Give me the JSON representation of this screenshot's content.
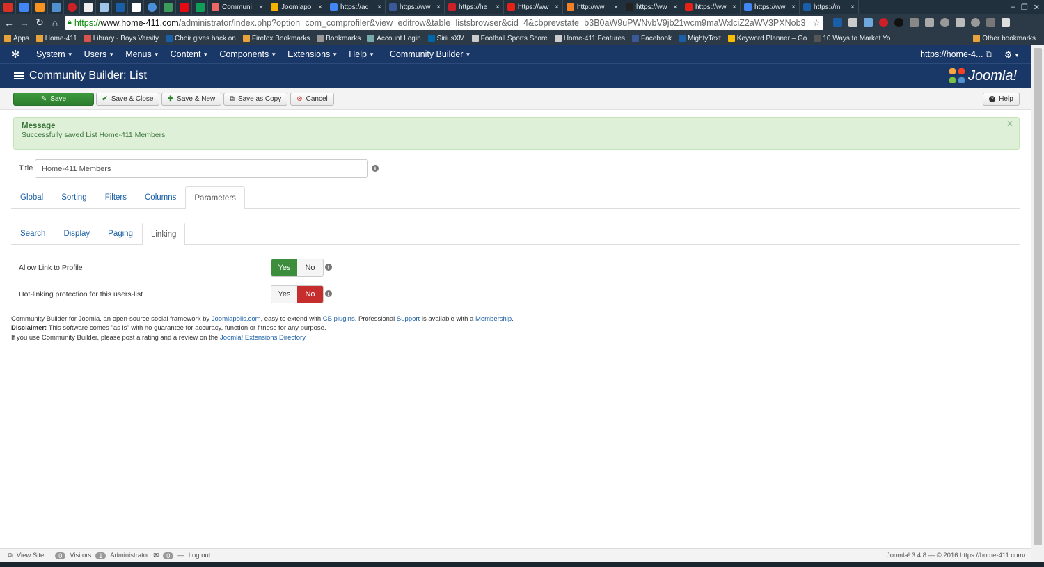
{
  "browser": {
    "tabs": [
      {
        "label": "Communi",
        "color": "#e66"
      },
      {
        "label": "Joomlapo",
        "color": "#f5b400"
      },
      {
        "label": "https://ac",
        "color": "#4285f4"
      },
      {
        "label": "https://ww",
        "color": "#3b5998"
      },
      {
        "label": "https://he",
        "color": "#cb2027"
      },
      {
        "label": "https://ww",
        "color": "#e62117"
      },
      {
        "label": "http://ww",
        "color": "#f48024"
      },
      {
        "label": "https://ww",
        "color": "#222"
      },
      {
        "label": "https://ww",
        "color": "#e62117"
      },
      {
        "label": "https://ww",
        "color": "#4285f4"
      },
      {
        "label": "https://m",
        "color": "#1a5ea8"
      }
    ],
    "tab_close": "×",
    "url": {
      "scheme": "https://",
      "domain": "www.home-411.com",
      "path": "/administrator/index.php?option=com_comprofiler&view=editrow&table=listsbrowser&cid=4&cbprevstate=b3B0aW9uPWNvbV9jb21wcm9maWxlciZ2aWV3PXNob3"
    },
    "bookmarks": [
      {
        "label": "Apps",
        "color": "#e8a33c"
      },
      {
        "label": "Home-411",
        "color": "#e8a33c"
      },
      {
        "label": "Library - Boys Varsity",
        "color": "#d9534f"
      },
      {
        "label": "Choir gives back on",
        "color": "#1a5ea8"
      },
      {
        "label": "Firefox Bookmarks",
        "color": "#e8a33c"
      },
      {
        "label": "Bookmarks",
        "color": "#999"
      },
      {
        "label": "Account Login",
        "color": "#7aa"
      },
      {
        "label": "SiriusXM",
        "color": "#0066aa"
      },
      {
        "label": "Football Sports Score",
        "color": "#ccc"
      },
      {
        "label": "Home-411 Features",
        "color": "#ccc"
      },
      {
        "label": "Facebook",
        "color": "#3b5998"
      },
      {
        "label": "MightyText",
        "color": "#1a5ea8"
      },
      {
        "label": "Keyword Planner – Go",
        "color": "#fbbc05"
      },
      {
        "label": "10 Ways to Market Yo",
        "color": "#555"
      }
    ],
    "other_bookmarks": "Other bookmarks"
  },
  "jnav": {
    "menus": [
      "System",
      "Users",
      "Menus",
      "Content",
      "Components",
      "Extensions",
      "Help",
      "Community Builder"
    ],
    "site_link": "https://home-4..."
  },
  "header": {
    "title": "Community Builder: List",
    "brand": "Joomla!"
  },
  "toolbar": {
    "save": "Save",
    "save_close": "Save & Close",
    "save_new": "Save & New",
    "save_copy": "Save as Copy",
    "cancel": "Cancel",
    "help": "Help"
  },
  "alert": {
    "heading": "Message",
    "message": "Successfully saved List Home-411 Members"
  },
  "form": {
    "title_label": "Title",
    "title_value": "Home-411 Members"
  },
  "tabs": {
    "main": [
      "Global",
      "Sorting",
      "Filters",
      "Columns",
      "Parameters"
    ],
    "sub": [
      "Search",
      "Display",
      "Paging",
      "Linking"
    ]
  },
  "fields": [
    {
      "label": "Allow Link to Profile",
      "yes": "Yes",
      "no": "No"
    },
    {
      "label": "Hot-linking protection for this users-list",
      "yes": "Yes",
      "no": "No"
    }
  ],
  "footer": {
    "l1_a": "Community Builder for Joomla, an open-source social framework by ",
    "l1_link1": "Joomlapolis.com",
    "l1_b": ", easy to extend with ",
    "l1_link2": "CB plugins",
    "l1_c": ". Professional ",
    "l1_link3": "Support",
    "l1_d": " is available with a ",
    "l1_link4": "Membership",
    "l1_e": ".",
    "l2_bold": "Disclaimer:",
    "l2_rest": " This software comes \"as is\" with no guarantee for accuracy, function or fitness for any purpose.",
    "l3_a": "If you use Community Builder, please post a rating and a review on the ",
    "l3_link": "Joomla! Extensions Directory",
    "l3_b": "."
  },
  "status": {
    "view_site": "View Site",
    "visitors_count": "0",
    "visitors": "Visitors",
    "admin_count": "1",
    "administrator": "Administrator",
    "messages_count": "0",
    "logout": "Log out",
    "version": "Joomla! 3.4.8 — © 2016 https://home-411.com/"
  }
}
